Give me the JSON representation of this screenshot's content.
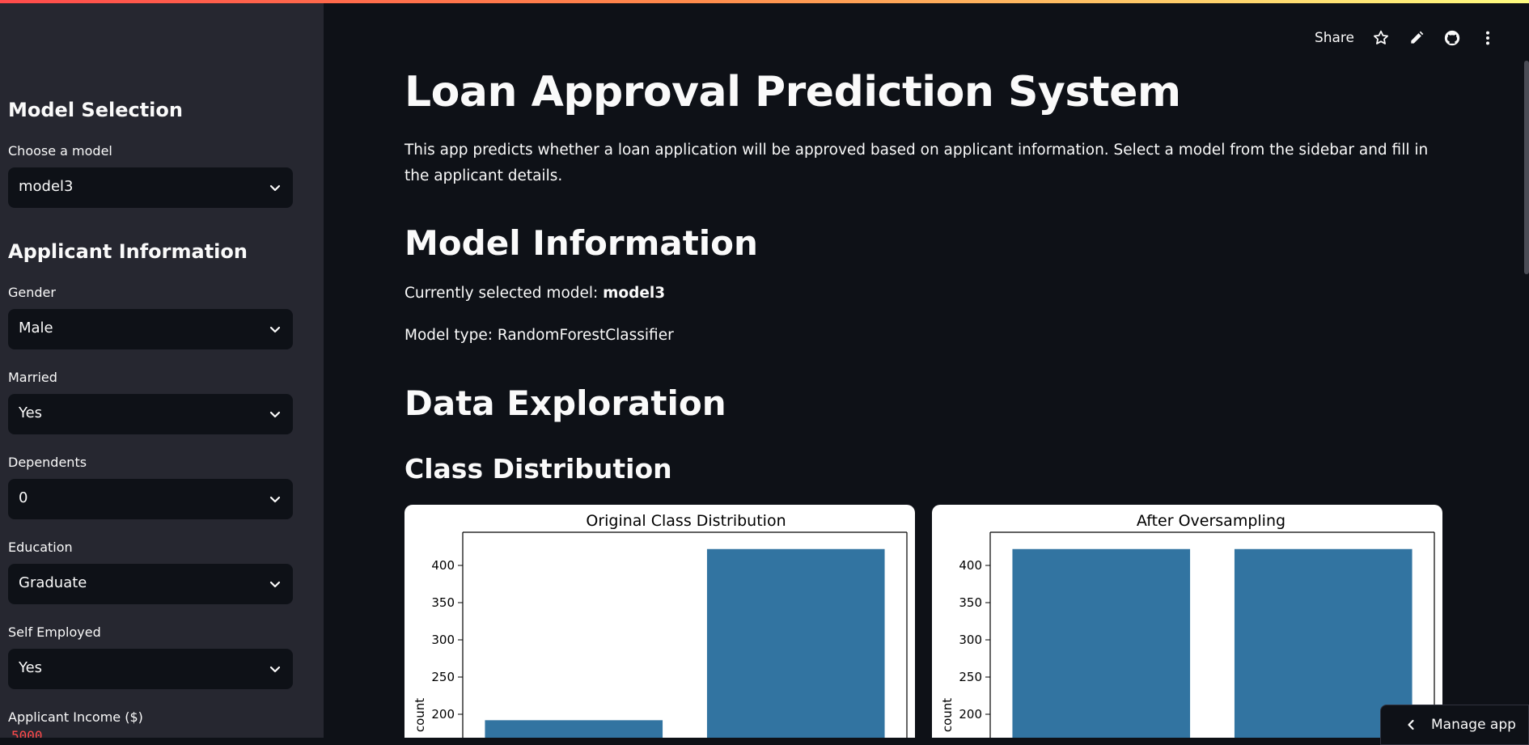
{
  "sidebar": {
    "model_heading": "Model Selection",
    "model_label": "Choose a model",
    "model_value": "model3",
    "applicant_heading": "Applicant Information",
    "fields": [
      {
        "label": "Gender",
        "value": "Male"
      },
      {
        "label": "Married",
        "value": "Yes"
      },
      {
        "label": "Dependents",
        "value": "0"
      },
      {
        "label": "Education",
        "value": "Graduate"
      },
      {
        "label": "Self Employed",
        "value": "Yes"
      }
    ],
    "income_label": "Applicant Income ($)",
    "income_value": "5000"
  },
  "toolbar": {
    "share_label": "Share",
    "icons": [
      "star-icon",
      "pencil-icon",
      "github-icon",
      "more-vert-icon"
    ]
  },
  "main": {
    "title": "Loan Approval Prediction System",
    "intro": "This app predicts whether a loan application will be approved based on applicant information. Select a model from the sidebar and fill in the applicant details.",
    "model_info_heading": "Model Information",
    "selected_model_prefix": "Currently selected model: ",
    "selected_model_value": "model3",
    "model_type_text": "Model type: RandomForestClassifier",
    "data_exploration_heading": "Data Exploration",
    "class_dist_heading": "Class Distribution"
  },
  "manage_app_label": "Manage app",
  "colors": {
    "accent": "#ff4b4b",
    "bar": "#3274a1",
    "sidebar_bg": "#262730",
    "main_bg": "#0e1117"
  },
  "chart_data": [
    {
      "type": "bar",
      "title": "Original Class Distribution",
      "ylabel": "count",
      "values": [
        192,
        422
      ],
      "yticks": [
        200,
        250,
        300,
        350,
        400
      ]
    },
    {
      "type": "bar",
      "title": "After Oversampling",
      "ylabel": "count",
      "values": [
        422,
        422
      ],
      "yticks": [
        200,
        250,
        300,
        350,
        400
      ]
    }
  ]
}
